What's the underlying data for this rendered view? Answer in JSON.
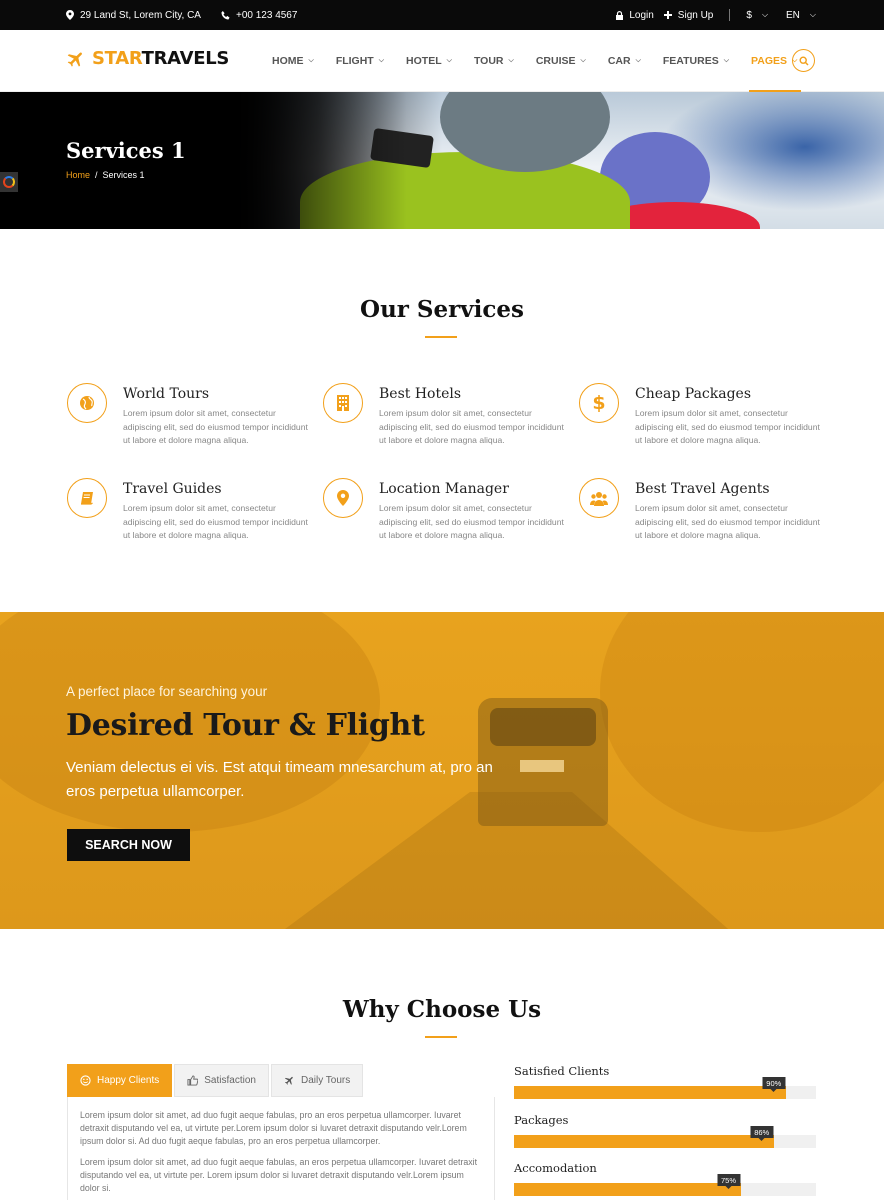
{
  "topbar": {
    "address": "29 Land St, Lorem City, CA",
    "phone": "+00 123 4567",
    "login": "Login",
    "signup": "Sign Up",
    "currency": "$",
    "language": "EN"
  },
  "logo": {
    "star": "STAR",
    "travels": "TRAVELS"
  },
  "nav": {
    "items": [
      {
        "label": "HOME"
      },
      {
        "label": "FLIGHT"
      },
      {
        "label": "HOTEL"
      },
      {
        "label": "TOUR"
      },
      {
        "label": "CRUISE"
      },
      {
        "label": "CAR"
      },
      {
        "label": "FEATURES"
      },
      {
        "label": "PAGES"
      }
    ],
    "active": "PAGES"
  },
  "hero": {
    "title": "Services 1",
    "breadcrumb": {
      "home": "Home",
      "separator": "/",
      "current": "Services 1"
    }
  },
  "services": {
    "title": "Our Services",
    "items": [
      {
        "name": "World Tours",
        "icon": "globe-icon",
        "desc": "Lorem ipsum dolor sit amet, consectetur adipiscing elit, sed do eiusmod tempor incididunt ut labore et dolore magna aliqua."
      },
      {
        "name": "Best Hotels",
        "icon": "building-icon",
        "desc": "Lorem ipsum dolor sit amet, consectetur adipiscing elit, sed do eiusmod tempor incididunt ut labore et dolore magna aliqua."
      },
      {
        "name": "Cheap Packages",
        "icon": "dollar-icon",
        "desc": "Lorem ipsum dolor sit amet, consectetur adipiscing elit, sed do eiusmod tempor incididunt ut labore et dolore magna aliqua."
      },
      {
        "name": "Travel Guides",
        "icon": "book-icon",
        "desc": "Lorem ipsum dolor sit amet, consectetur adipiscing elit, sed do eiusmod tempor incididunt ut labore et dolore magna aliqua."
      },
      {
        "name": "Location Manager",
        "icon": "map-pin-icon",
        "desc": "Lorem ipsum dolor sit amet, consectetur adipiscing elit, sed do eiusmod tempor incididunt ut labore et dolore magna aliqua."
      },
      {
        "name": "Best Travel Agents",
        "icon": "users-icon",
        "desc": "Lorem ipsum dolor sit amet, consectetur adipiscing elit, sed do eiusmod tempor incididunt ut labore et dolore magna aliqua."
      }
    ]
  },
  "cta": {
    "subtitle": "A perfect place for searching your",
    "title": "Desired Tour & Flight",
    "lead": "Veniam delectus ei vis. Est atqui timeam mnesarchum at, pro an eros perpetua ullamcorper.",
    "button": "SEARCH NOW"
  },
  "why": {
    "title": "Why Choose Us",
    "tabs": [
      {
        "label": "Happy Clients",
        "icon": "smile-icon"
      },
      {
        "label": "Satisfaction",
        "icon": "thumbs-up-icon"
      },
      {
        "label": "Daily Tours",
        "icon": "plane-icon"
      }
    ],
    "active_tab": "Happy Clients",
    "paragraphs": [
      "Lorem ipsum dolor sit amet, ad duo fugit aeque fabulas, pro an eros perpetua ullamcorper. Iuvaret detraxit disputando vel ea, ut virtute per.Lorem ipsum dolor si luvaret detraxit disputando velr.Lorem ipsum dolor si. Ad duo fugit aeque fabulas, pro an eros perpetua ullamcorper.",
      "Lorem ipsum dolor sit amet, ad duo fugit aeque fabulas, an eros perpetua ullamcorper. Iuvaret detraxit disputando vel ea, ut virtute per. Lorem ipsum dolor si luvaret detraxit disputando velr.Lorem ipsum dolor si."
    ],
    "skills": [
      {
        "label": "Satisfied Clients",
        "percent": 90,
        "text": "90%"
      },
      {
        "label": "Packages",
        "percent": 86,
        "text": "86%"
      },
      {
        "label": "Accomodation",
        "percent": 75,
        "text": "75%"
      }
    ]
  },
  "colors": {
    "accent": "#f2a01a",
    "dark": "#0a0a0a"
  }
}
